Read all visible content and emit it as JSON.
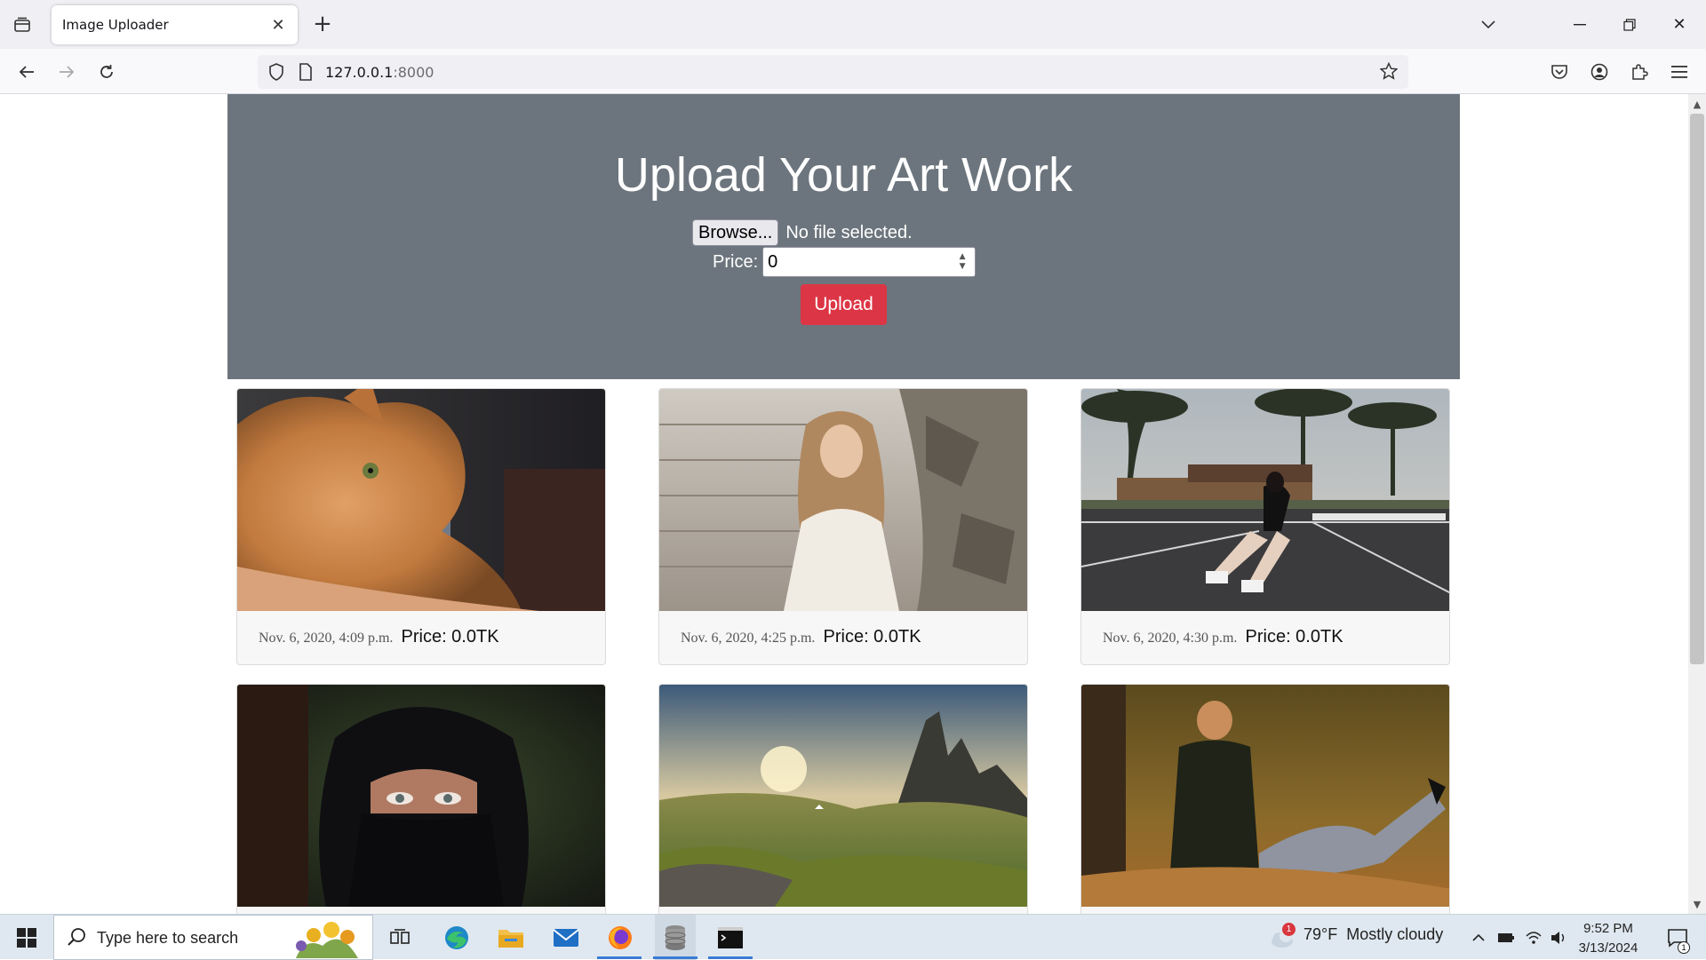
{
  "browser": {
    "tab_title": "Image Uploader",
    "url_host": "127.0.0.1",
    "url_port": ":8000"
  },
  "page": {
    "heading": "Upload Your Art Work",
    "browse_label": "Browse...",
    "no_file_text": "No file selected.",
    "price_label": "Price:",
    "price_value": "0",
    "upload_label": "Upload"
  },
  "cards": [
    {
      "date": "Nov. 6, 2020, 4:09 p.m.",
      "price": "Price: 0.0TK",
      "image": "cat-photo"
    },
    {
      "date": "Nov. 6, 2020, 4:25 p.m.",
      "price": "Price: 0.0TK",
      "image": "woman-on-steps-photo"
    },
    {
      "date": "Nov. 6, 2020, 4:30 p.m.",
      "price": "Price: 0.0TK",
      "image": "rollerskater-photo"
    },
    {
      "image": "hijab-woman-photo"
    },
    {
      "image": "mountain-landscape-photo"
    },
    {
      "image": "couple-in-field-photo"
    }
  ],
  "taskbar": {
    "search_placeholder": "Type here to search",
    "weather_temp": "79°F",
    "weather_text": "Mostly cloudy",
    "weather_badge": "1",
    "time": "9:52 PM",
    "date": "3/13/2024",
    "notification_count": "1"
  },
  "colors": {
    "hero_bg": "#6c757d",
    "upload_button": "#dc3545"
  }
}
